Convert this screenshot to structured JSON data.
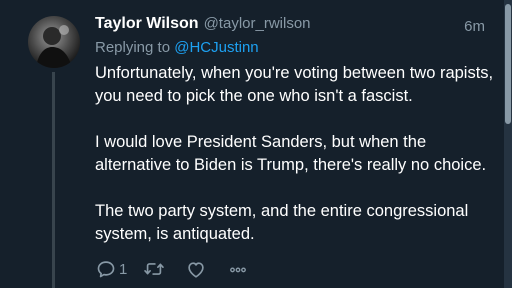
{
  "tweet": {
    "author_name": "Taylor Wilson",
    "author_handle": "@taylor_rwilson",
    "time": "6m",
    "replying_prefix": "Replying to ",
    "replying_to": "@HCJustinn",
    "paragraphs": [
      "Unfortunately, when you're voting between two rapists, you need to pick the one who isn't a fascist.",
      "I would love President Sanders, but when the alternative to Biden is Trump, there's really no choice.",
      "The two party system, and the entire congressional system, is antiquated."
    ]
  },
  "actions": {
    "reply_icon": "reply-icon",
    "reply_count": "1",
    "retweet_icon": "retweet-icon",
    "like_icon": "heart-icon",
    "more_icon": "more-icon"
  },
  "colors": {
    "background": "#15202b",
    "text": "#ffffff",
    "secondary": "#8899a6",
    "link": "#1da1f2",
    "thread_line": "#38444d"
  }
}
